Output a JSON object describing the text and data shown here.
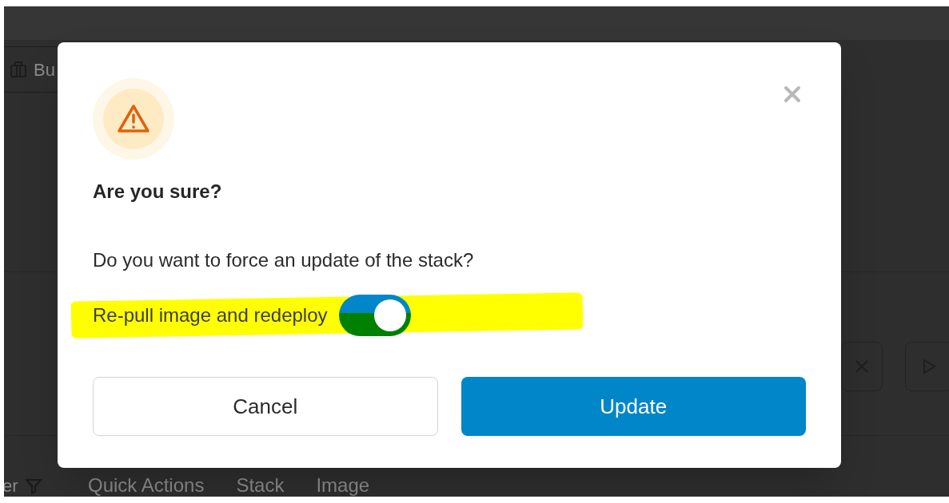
{
  "background": {
    "toolbar_button": "Bu",
    "filter_label": "er",
    "columns": [
      "Quick Actions",
      "Stack",
      "Image"
    ]
  },
  "dialog": {
    "title": "Are you sure?",
    "message": "Do you want to force an update of the stack?",
    "option": {
      "label": "Re-pull image and redeploy",
      "on": true,
      "highlighted": true
    },
    "buttons": [
      {
        "kind": "secondary",
        "label": "Cancel"
      },
      {
        "kind": "primary",
        "label": "Update"
      }
    ]
  }
}
